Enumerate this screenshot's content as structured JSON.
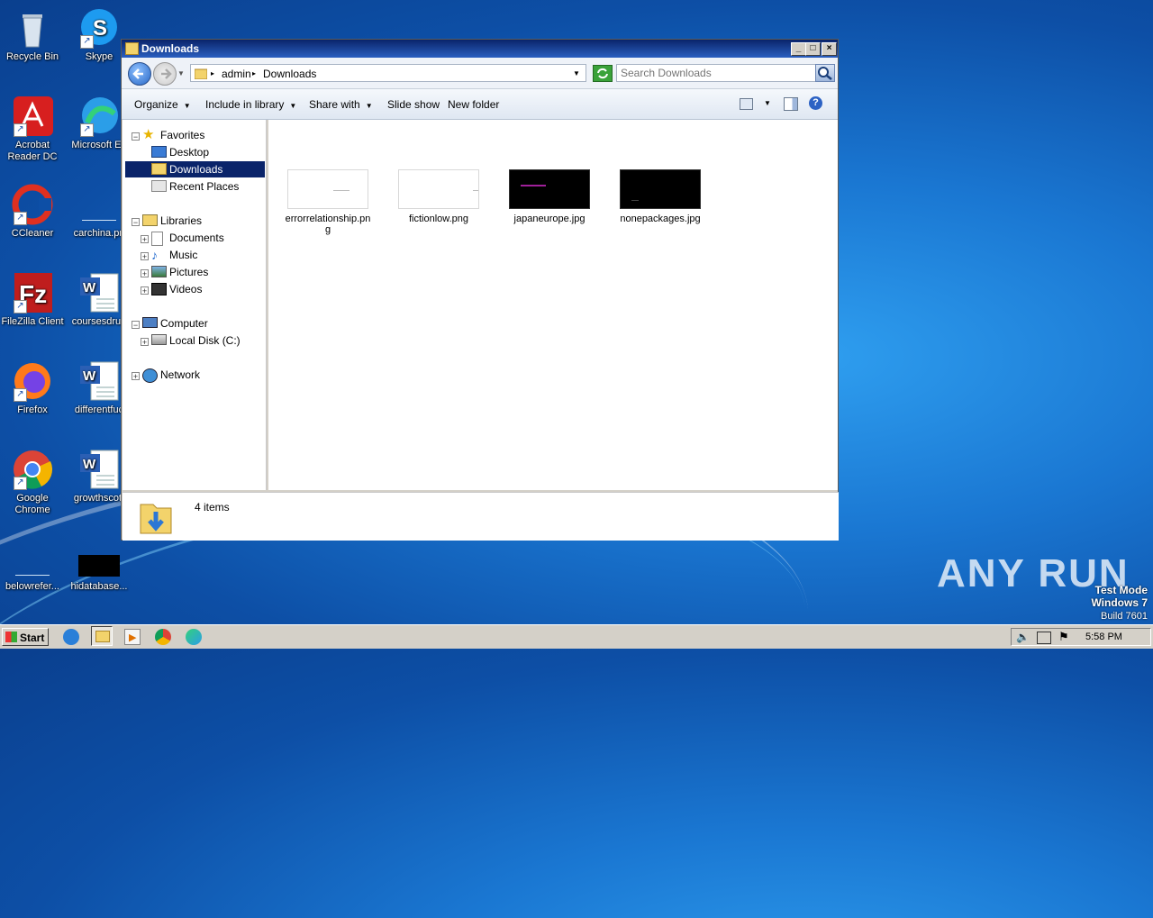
{
  "desktop": {
    "icons": [
      {
        "label": "Recycle Bin"
      },
      {
        "label": "Skype"
      },
      {
        "label": "Acrobat Reader DC"
      },
      {
        "label": "Microsoft Ed"
      },
      {
        "label": "CCleaner"
      },
      {
        "label": "carchina.pn"
      },
      {
        "label": "FileZilla Client"
      },
      {
        "label": "coursesdrug"
      },
      {
        "label": "Firefox"
      },
      {
        "label": "differentfuc"
      },
      {
        "label": "Google Chrome"
      },
      {
        "label": "growthscott"
      },
      {
        "label": "belowrefer..."
      },
      {
        "label": "hidatabase..."
      }
    ]
  },
  "window": {
    "title": "Downloads",
    "address": {
      "segments": [
        "admin",
        "Downloads"
      ]
    },
    "search": {
      "placeholder": "Search Downloads"
    },
    "toolbar": {
      "organize": "Organize",
      "include_in_library": "Include in library",
      "share_with": "Share with",
      "slide_show": "Slide show",
      "new_folder": "New folder"
    },
    "nav": {
      "favorites": "Favorites",
      "desktop": "Desktop",
      "downloads": "Downloads",
      "recent_places": "Recent Places",
      "libraries": "Libraries",
      "documents": "Documents",
      "music": "Music",
      "pictures": "Pictures",
      "videos": "Videos",
      "computer": "Computer",
      "local_disk": "Local Disk (C:)",
      "network": "Network"
    },
    "files": [
      {
        "name": "errorrelationship.png"
      },
      {
        "name": "fictionlow.png"
      },
      {
        "name": "japaneurope.jpg"
      },
      {
        "name": "nonepackages.jpg"
      }
    ],
    "status": {
      "items_count": "4 items"
    }
  },
  "taskbar": {
    "start_label": "Start",
    "clock": "5:58 PM"
  },
  "watermark": {
    "brand": "ANY RUN",
    "test_mode": "Test Mode",
    "os": "Windows 7",
    "build": "Build 7601"
  }
}
